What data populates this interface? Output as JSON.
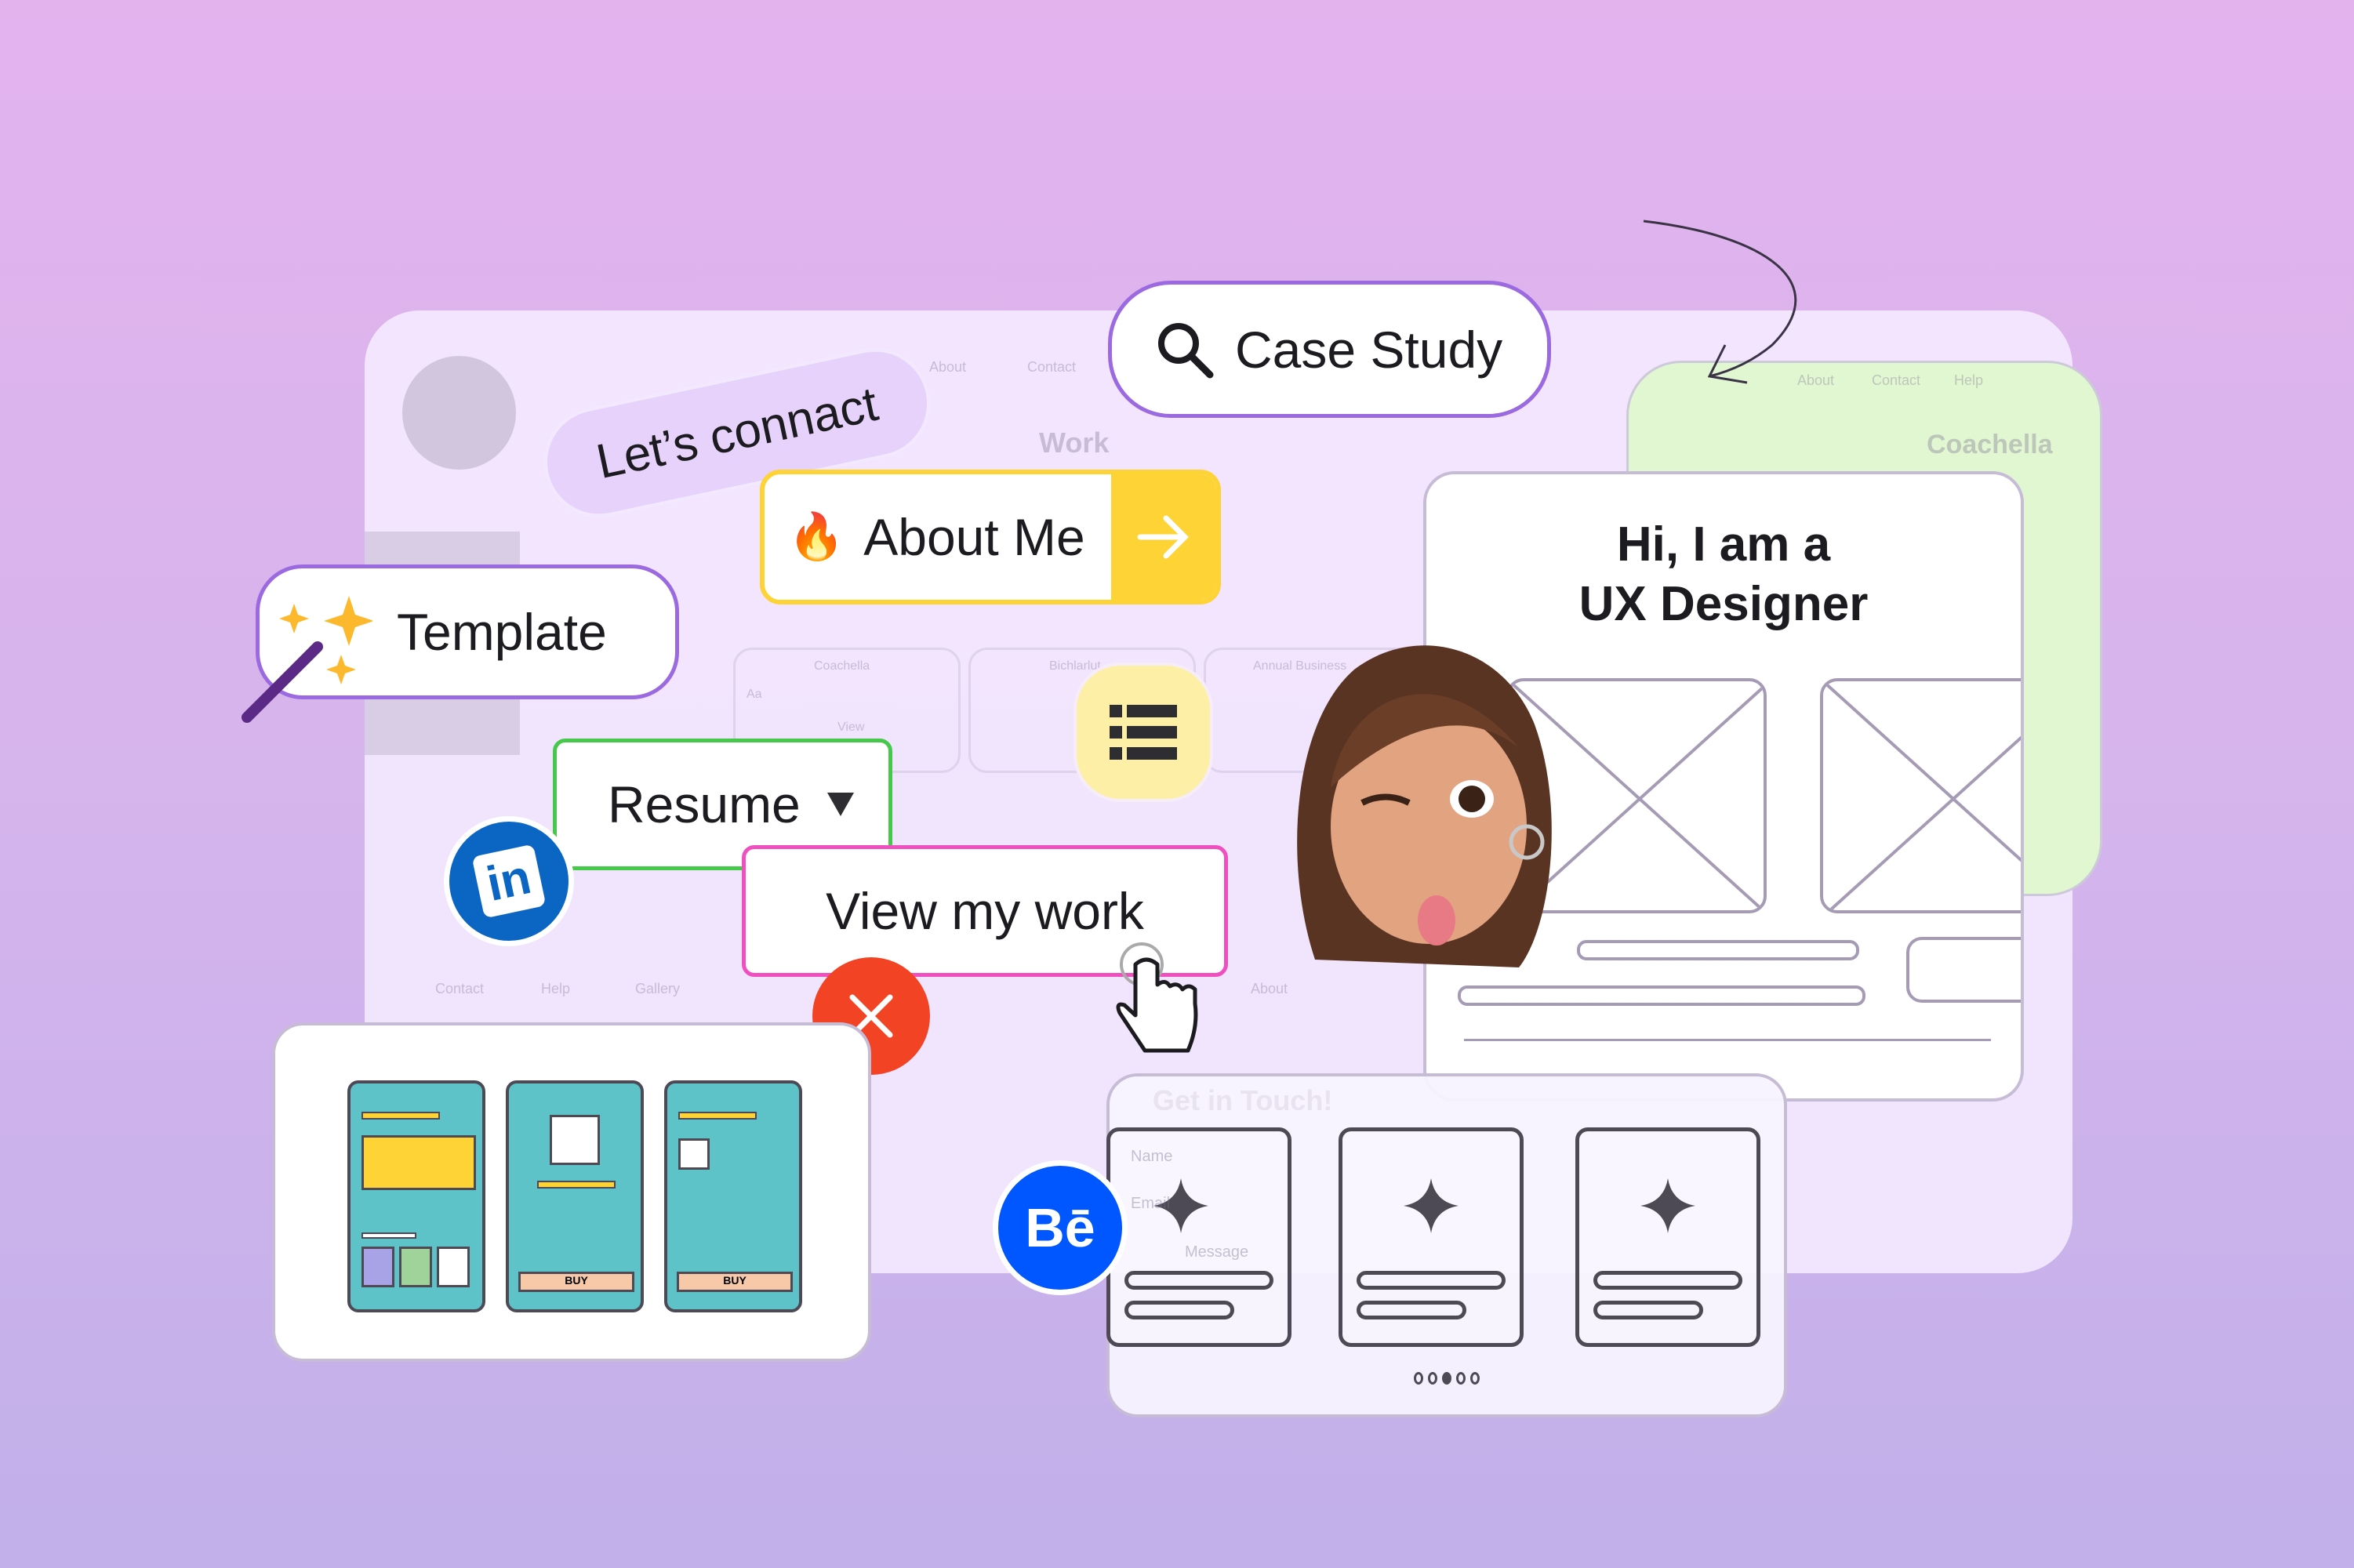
{
  "background_panel": {
    "nav": [
      "About",
      "Contact"
    ],
    "section_title": "Work",
    "cards": [
      "Coachella",
      "Bichlarlut",
      "Annual Business"
    ],
    "card_button": "View",
    "font_sample": "Aa",
    "footer_nav": [
      "Contact",
      "Help",
      "Gallery"
    ],
    "about_tab": "About"
  },
  "green_card": {
    "nav": [
      "About",
      "Contact",
      "Help"
    ],
    "title": "Coachella"
  },
  "buttons": {
    "case_study": {
      "label": "Case Study",
      "icon": "search-icon"
    },
    "lets_connect": {
      "label": "Let’s connact"
    },
    "about_me": {
      "label": "About Me",
      "icon": "fire-icon",
      "trailing_icon": "arrow-right-icon"
    },
    "template": {
      "label": "Template",
      "icon": "magic-wand-icon"
    },
    "list": {
      "icon": "list-icon"
    },
    "resume": {
      "label": "Resume",
      "icon": "caret-down-icon"
    },
    "view_my_work": {
      "label": "View my work",
      "cursor": "hand-pointer-icon"
    },
    "close": {
      "icon": "close-icon"
    },
    "linkedin": {
      "label": "in"
    },
    "behance": {
      "label": "Bē"
    }
  },
  "hero_card": {
    "title_line1": "Hi, I am a",
    "title_line2": "UX Designer"
  },
  "contact_card": {
    "title": "Get in Touch!",
    "field_labels": [
      "Name",
      "Email",
      "Message"
    ],
    "carousel_active_index": 2,
    "carousel_count": 5
  },
  "flow_card": {
    "buy_label": "BUY"
  },
  "colors": {
    "purple_border": "#9b6ae0",
    "yellow": "#fdd335",
    "green": "#46c84a",
    "pink": "#f04fc0",
    "red": "#f24324",
    "linkedin": "#0a66c2",
    "behance": "#0057ff"
  }
}
